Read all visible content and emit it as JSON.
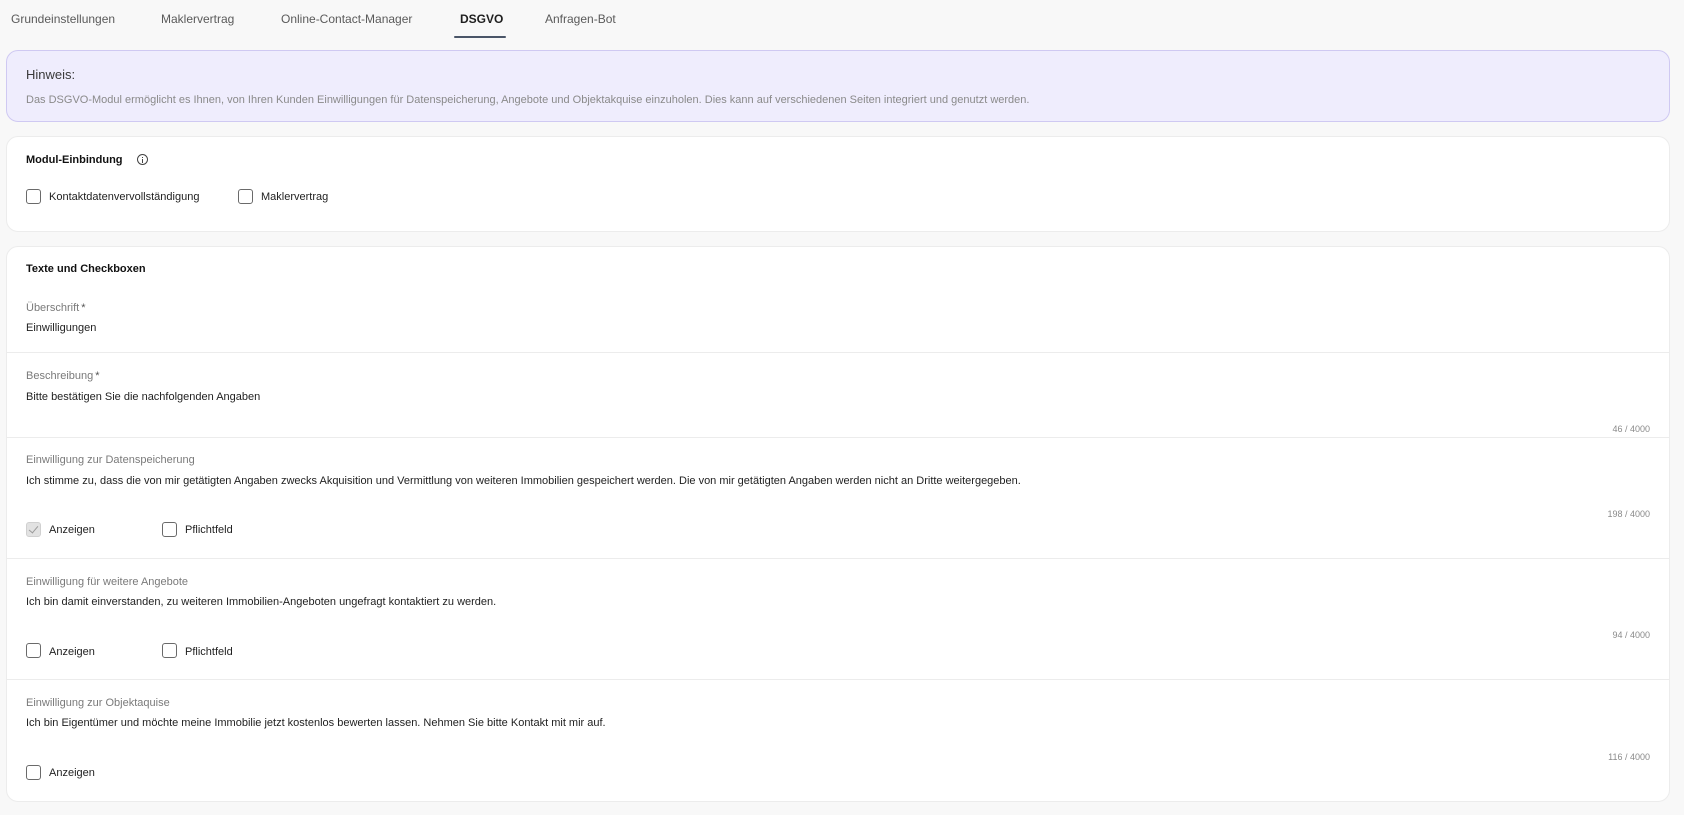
{
  "tabs": [
    {
      "label": "Grundeinstellungen"
    },
    {
      "label": "Maklervertrag"
    },
    {
      "label": "Online-Contact-Manager"
    },
    {
      "label": "DSGVO"
    },
    {
      "label": "Anfragen-Bot"
    }
  ],
  "notice": {
    "title": "Hinweis:",
    "text": "Das DSGVO-Modul ermöglicht es Ihnen, von Ihren Kunden Einwilligungen für Datenspeicherung, Angebote und Objektakquise einzuholen. Dies kann auf verschiedenen Seiten integriert und genutzt werden."
  },
  "module": {
    "title": "Modul-Einbindung",
    "options": [
      {
        "label": "Kontaktdatenvervollständigung",
        "checked": false
      },
      {
        "label": "Maklervertrag",
        "checked": false
      }
    ]
  },
  "texts": {
    "title": "Texte und Checkboxen",
    "heading": {
      "label": "Überschrift",
      "required_mark": "*",
      "value": "Einwilligungen"
    },
    "description": {
      "label": "Beschreibung",
      "required_mark": "*",
      "value": "Bitte bestätigen Sie die nachfolgenden Angaben",
      "counter": "46 / 4000"
    },
    "data_storage": {
      "label": "Einwilligung zur Datenspeicherung",
      "value": "Ich stimme zu, dass die von mir getätigten Angaben zwecks Akquisition und Vermittlung von weiteren Immobilien gespeichert werden. Die von mir getätigten Angaben werden nicht an Dritte weitergegeben.",
      "counter": "198 / 4000",
      "show_label": "Anzeigen",
      "show_checked": true,
      "show_disabled": true,
      "required_label": "Pflichtfeld",
      "required_checked": false
    },
    "offers": {
      "label": "Einwilligung für weitere Angebote",
      "value": "Ich bin damit einverstanden, zu weiteren Immobilien-Angeboten ungefragt kontaktiert zu werden.",
      "counter": "94 / 4000",
      "show_label": "Anzeigen",
      "show_checked": false,
      "required_label": "Pflichtfeld",
      "required_checked": false
    },
    "acquisition": {
      "label": "Einwilligung zur Objektaquise",
      "value": "Ich bin Eigentümer und möchte meine Immobilie jetzt kostenlos bewerten lassen. Nehmen Sie bitte Kontakt mit mir auf.",
      "counter": "116 / 4000",
      "show_label": "Anzeigen",
      "show_checked": false
    }
  }
}
